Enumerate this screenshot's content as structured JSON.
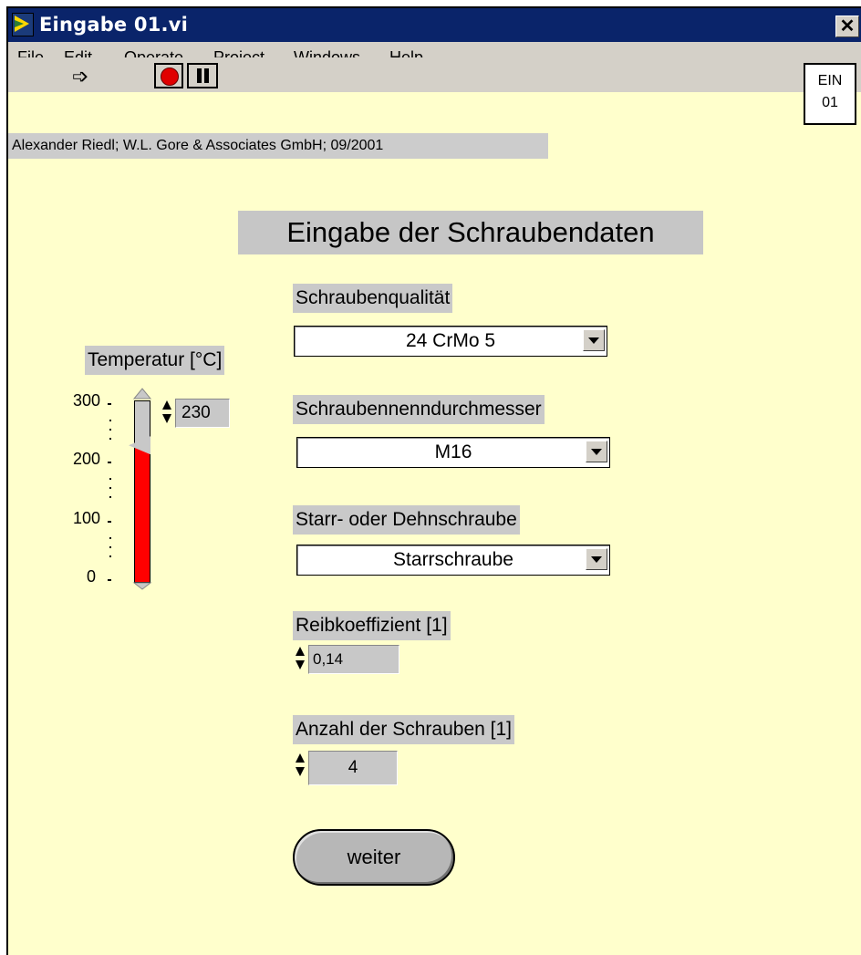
{
  "window": {
    "title": "Eingabe 01.vi",
    "close_glyph": "✕"
  },
  "menu": [
    {
      "first": "F",
      "rest": "ile"
    },
    {
      "first": "E",
      "rest": "dit"
    },
    {
      "first": "O",
      "rest": "perate"
    },
    {
      "first": "P",
      "rest": "roject"
    },
    {
      "first": "W",
      "rest": "indows"
    },
    {
      "first": "H",
      "rest": "elp"
    }
  ],
  "toolbar": {
    "run_icon": "run-arrow-icon",
    "stop_icon": "abort-icon",
    "pause_icon": "pause-icon"
  },
  "vi_icon": {
    "line1": "EIN",
    "line2": "01"
  },
  "author_line": "Alexander Riedl; W.L. Gore & Associates GmbH; 09/2001",
  "page_title": "Eingabe der Schraubendaten",
  "temperature": {
    "label": "Temperatur [°C]",
    "value": "230",
    "value_num": 230,
    "max": 300,
    "ticks": [
      "300",
      "200",
      "100",
      "0"
    ],
    "fill_color": "#ff0000"
  },
  "schraubenqualitaet": {
    "label": "Schraubenqualität",
    "value": "24 CrMo 5"
  },
  "durchmesser": {
    "label": "Schraubennenndurchmesser",
    "value": "M16"
  },
  "schraubenart": {
    "label": "Starr- oder Dehnschraube",
    "value": "Starrschraube"
  },
  "reibkoeffizient": {
    "label": "Reibkoeffizient [1]",
    "value": "0,14"
  },
  "anzahl": {
    "label": "Anzahl der Schrauben [1]",
    "value": "4"
  },
  "weiter_button": "weiter",
  "colors": {
    "panel_bg": "#ffffcc",
    "titlebar": "#0a246a",
    "label_bg": "#c9c9c9"
  }
}
